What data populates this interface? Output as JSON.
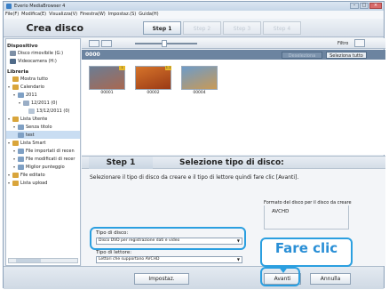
{
  "window": {
    "title": "Everio MediaBrowser 4"
  },
  "menu": [
    "File(F)",
    "Modifica(E)",
    "Visualizza(V)",
    "Finestra(W)",
    "Impostaz.(S)",
    "Guida(H)"
  ],
  "header": {
    "title": "Crea disco",
    "steps": [
      "Step 1",
      "Step 2",
      "Step 3",
      "Step 4"
    ],
    "active_step": 0
  },
  "sidebar": {
    "section_device": "Dispositivo",
    "devices": [
      "Disco rimovibile (G:)",
      "Videocamera (H:)"
    ],
    "section_library": "Libreria",
    "library": [
      {
        "label": "Mostra tutto",
        "level": 0
      },
      {
        "label": "Calendario",
        "level": 0
      },
      {
        "label": "2011",
        "level": 1
      },
      {
        "label": "12/2011 (0)",
        "level": 2
      },
      {
        "label": "13/12/2011 (0)",
        "level": 3
      },
      {
        "label": "Lista Utente",
        "level": 0
      },
      {
        "label": "Senza titolo",
        "level": 1
      },
      {
        "label": "test",
        "level": 1,
        "selected": true
      },
      {
        "label": "Lista Smart",
        "level": 0
      },
      {
        "label": "File importati di recen",
        "level": 1
      },
      {
        "label": "File modificati di recer",
        "level": 1
      },
      {
        "label": "Miglior punteggio",
        "level": 1
      },
      {
        "label": "File editato",
        "level": 0
      },
      {
        "label": "Lista upload",
        "level": 0
      }
    ]
  },
  "toolbar": {
    "filter_label": "Filtro"
  },
  "library_bar": {
    "count": "0000",
    "deselect_label": "Deseleziona",
    "select_all_label": "Seleziona tutto"
  },
  "thumbnails": [
    {
      "id": "00001",
      "badge": "1",
      "colors": [
        "#6b7d94",
        "#a96850"
      ]
    },
    {
      "id": "00002",
      "badge": "1.1",
      "colors": [
        "#d6742a",
        "#9a3a16"
      ]
    },
    {
      "id": "00004",
      "badge": "",
      "colors": [
        "#6d9bc9",
        "#c99a56"
      ]
    }
  ],
  "panel": {
    "step": "Step 1",
    "heading": "Selezione tipo di disco:",
    "instruction": "Selezionare il tipo di disco da creare e il tipo di lettore quindi fare clic [Avanti].",
    "disc_type_label": "Tipo di disco:",
    "disc_type_value": "Disco DVD per registrazione dati e video",
    "player_type_label": "Tipo di lettore:",
    "player_type_value": "Lettori che supportano AVCHD",
    "format_label": "Formato del disco per il disco da creare",
    "format_value": "AVCHD"
  },
  "buttons": {
    "settings": "Impostaz.",
    "next": "Avanti",
    "cancel": "Annulla"
  },
  "callout": {
    "text": "Fare clic",
    "color": "#2a8fd6"
  }
}
